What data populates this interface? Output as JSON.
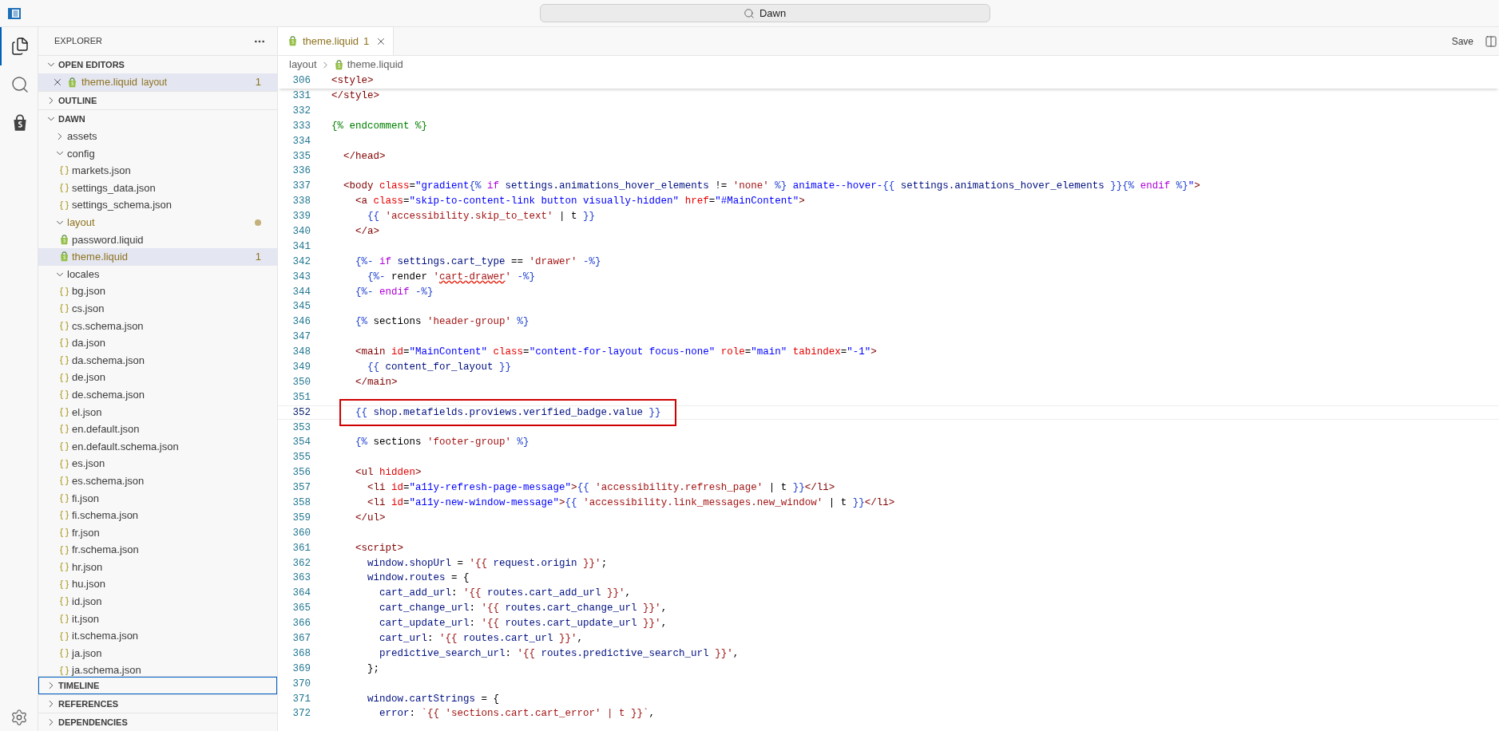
{
  "title_bar": {
    "search": "Dawn"
  },
  "activity_bar": [
    {
      "kind": "files",
      "selected": true
    },
    {
      "kind": "search",
      "selected": false
    },
    {
      "kind": "shop",
      "selected": false
    }
  ],
  "explorer": {
    "title": "EXPLORER",
    "sections": [
      {
        "label": "OPEN EDITORS",
        "expanded": true,
        "focused": false,
        "editors": [
          {
            "name": "theme.liquid",
            "folder": "layout",
            "badge": "1",
            "selected": true,
            "warning": true
          }
        ]
      },
      {
        "label": "OUTLINE",
        "expanded": false,
        "focused": false
      },
      {
        "label": "DAWN",
        "expanded": true,
        "focused": false,
        "tree": [
          {
            "name": "assets",
            "kind": "folder",
            "expanded": false,
            "modified": false,
            "selected": false,
            "warning": false
          },
          {
            "name": "config",
            "kind": "folder",
            "expanded": true,
            "modified": false,
            "selected": false,
            "warning": false,
            "children": [
              {
                "name": "markets.json",
                "kind": "json",
                "selected": false,
                "warning": false
              },
              {
                "name": "settings_data.json",
                "kind": "json",
                "selected": false,
                "warning": false
              },
              {
                "name": "settings_schema.json",
                "kind": "json",
                "selected": false,
                "warning": false
              }
            ]
          },
          {
            "name": "layout",
            "kind": "folder",
            "expanded": true,
            "modified": true,
            "selected": false,
            "warning": true,
            "children": [
              {
                "name": "password.liquid",
                "kind": "liquid",
                "selected": false,
                "warning": false
              },
              {
                "name": "theme.liquid",
                "kind": "liquid",
                "selected": true,
                "warning": true,
                "badge": "1"
              }
            ]
          },
          {
            "name": "locales",
            "kind": "folder",
            "expanded": true,
            "modified": false,
            "selected": false,
            "warning": false,
            "children": [
              {
                "name": "bg.json",
                "kind": "json",
                "selected": false,
                "warning": false
              },
              {
                "name": "cs.json",
                "kind": "json",
                "selected": false,
                "warning": false
              },
              {
                "name": "cs.schema.json",
                "kind": "json",
                "selected": false,
                "warning": false
              },
              {
                "name": "da.json",
                "kind": "json",
                "selected": false,
                "warning": false
              },
              {
                "name": "da.schema.json",
                "kind": "json",
                "selected": false,
                "warning": false
              },
              {
                "name": "de.json",
                "kind": "json",
                "selected": false,
                "warning": false
              },
              {
                "name": "de.schema.json",
                "kind": "json",
                "selected": false,
                "warning": false
              },
              {
                "name": "el.json",
                "kind": "json",
                "selected": false,
                "warning": false
              },
              {
                "name": "en.default.json",
                "kind": "json",
                "selected": false,
                "warning": false
              },
              {
                "name": "en.default.schema.json",
                "kind": "json",
                "selected": false,
                "warning": false
              },
              {
                "name": "es.json",
                "kind": "json",
                "selected": false,
                "warning": false
              },
              {
                "name": "es.schema.json",
                "kind": "json",
                "selected": false,
                "warning": false
              },
              {
                "name": "fi.json",
                "kind": "json",
                "selected": false,
                "warning": false
              },
              {
                "name": "fi.schema.json",
                "kind": "json",
                "selected": false,
                "warning": false
              },
              {
                "name": "fr.json",
                "kind": "json",
                "selected": false,
                "warning": false
              },
              {
                "name": "fr.schema.json",
                "kind": "json",
                "selected": false,
                "warning": false
              },
              {
                "name": "hr.json",
                "kind": "json",
                "selected": false,
                "warning": false
              },
              {
                "name": "hu.json",
                "kind": "json",
                "selected": false,
                "warning": false
              },
              {
                "name": "id.json",
                "kind": "json",
                "selected": false,
                "warning": false
              },
              {
                "name": "it.json",
                "kind": "json",
                "selected": false,
                "warning": false
              },
              {
                "name": "it.schema.json",
                "kind": "json",
                "selected": false,
                "warning": false
              },
              {
                "name": "ja.json",
                "kind": "json",
                "selected": false,
                "warning": false
              },
              {
                "name": "ja.schema.json",
                "kind": "json",
                "selected": false,
                "warning": false
              }
            ]
          }
        ]
      },
      {
        "label": "TIMELINE",
        "expanded": false,
        "focused": true
      },
      {
        "label": "REFERENCES",
        "expanded": false,
        "focused": false
      },
      {
        "label": "DEPENDENCIES",
        "expanded": false,
        "focused": false
      }
    ]
  },
  "tabs": [
    {
      "name": "theme.liquid",
      "badge": "1",
      "selected": true,
      "warning": true
    }
  ],
  "save": "Save",
  "breadcrumb": [
    {
      "text": "layout",
      "kind": "folder"
    },
    {
      "text": "theme.liquid",
      "kind": "liquid"
    }
  ],
  "editor": {
    "sticky": {
      "number": "306",
      "current": false,
      "boxed": false,
      "tokens": [
        {
          "kind": "tag",
          "text": "<style>"
        }
      ]
    },
    "lines": [
      {
        "number": "331",
        "current": false,
        "boxed": false,
        "tokens": [
          {
            "kind": "tag",
            "text": "</style>"
          }
        ]
      },
      {
        "number": "332",
        "current": false,
        "boxed": false
      },
      {
        "number": "333",
        "current": false,
        "boxed": false,
        "tokens": [
          {
            "kind": "comment",
            "text": "{% endcomment %}"
          }
        ]
      },
      {
        "number": "334",
        "current": false,
        "boxed": false
      },
      {
        "number": "335",
        "current": false,
        "boxed": false,
        "tokens": [
          {
            "kind": "tag",
            "text": "  </head>"
          }
        ]
      },
      {
        "number": "336",
        "current": false,
        "boxed": false
      },
      {
        "number": "337",
        "current": false,
        "boxed": false,
        "tokens": [
          {
            "kind": "tag",
            "text": "  <body"
          },
          {
            "kind": "attr",
            "text": " class"
          },
          {
            "kind": "plain",
            "text": "="
          },
          {
            "kind": "string",
            "text": "\"gradient"
          },
          {
            "kind": "delim",
            "text": "{%"
          },
          {
            "kind": "keyword",
            "text": " if"
          },
          {
            "kind": "variable",
            "text": " settings.animations_hover_elements"
          },
          {
            "kind": "plain",
            "text": " != "
          },
          {
            "kind": "quote",
            "text": "'none'"
          },
          {
            "kind": "delim",
            "text": " %}"
          },
          {
            "kind": "string",
            "text": " animate--hover-"
          },
          {
            "kind": "delim",
            "text": "{{"
          },
          {
            "kind": "variable",
            "text": " settings.animations_hover_elements"
          },
          {
            "kind": "delim",
            "text": " }}{%"
          },
          {
            "kind": "keyword",
            "text": " endif"
          },
          {
            "kind": "delim",
            "text": " %}"
          },
          {
            "kind": "string",
            "text": "\""
          },
          {
            "kind": "tag",
            "text": ">"
          }
        ]
      },
      {
        "number": "338",
        "current": false,
        "boxed": false,
        "tokens": [
          {
            "kind": "tag",
            "text": "    <a"
          },
          {
            "kind": "attr",
            "text": " class"
          },
          {
            "kind": "plain",
            "text": "="
          },
          {
            "kind": "string",
            "text": "\"skip-to-content-link button visually-hidden\""
          },
          {
            "kind": "attr",
            "text": " href"
          },
          {
            "kind": "plain",
            "text": "="
          },
          {
            "kind": "string",
            "text": "\"#MainContent\""
          },
          {
            "kind": "tag",
            "text": ">"
          }
        ]
      },
      {
        "number": "339",
        "current": false,
        "boxed": false,
        "tokens": [
          {
            "kind": "delim",
            "text": "      {{"
          },
          {
            "kind": "quote",
            "text": " 'accessibility.skip_to_text'"
          },
          {
            "kind": "plain",
            "text": " | t "
          },
          {
            "kind": "delim",
            "text": "}}"
          }
        ]
      },
      {
        "number": "340",
        "current": false,
        "boxed": false,
        "tokens": [
          {
            "kind": "tag",
            "text": "    </a>"
          }
        ]
      },
      {
        "number": "341",
        "current": false,
        "boxed": false
      },
      {
        "number": "342",
        "current": false,
        "boxed": false,
        "tokens": [
          {
            "kind": "delim",
            "text": "    {%-"
          },
          {
            "kind": "keyword",
            "text": " if"
          },
          {
            "kind": "variable",
            "text": " settings.cart_type"
          },
          {
            "kind": "plain",
            "text": " == "
          },
          {
            "kind": "quote",
            "text": "'drawer'"
          },
          {
            "kind": "delim",
            "text": " -%}"
          }
        ]
      },
      {
        "number": "343",
        "current": false,
        "boxed": false,
        "tokens": [
          {
            "kind": "delim",
            "text": "      {%-"
          },
          {
            "kind": "plain",
            "text": " render "
          },
          {
            "kind": "quote",
            "text": "'"
          },
          {
            "kind": "error",
            "text": "cart-drawer"
          },
          {
            "kind": "quote",
            "text": "'"
          },
          {
            "kind": "delim",
            "text": " -%}"
          }
        ]
      },
      {
        "number": "344",
        "current": false,
        "boxed": false,
        "tokens": [
          {
            "kind": "delim",
            "text": "    {%-"
          },
          {
            "kind": "keyword",
            "text": " endif"
          },
          {
            "kind": "delim",
            "text": " -%}"
          }
        ]
      },
      {
        "number": "345",
        "current": false,
        "boxed": false
      },
      {
        "number": "346",
        "current": false,
        "boxed": false,
        "tokens": [
          {
            "kind": "delim",
            "text": "    {%"
          },
          {
            "kind": "plain",
            "text": " sections "
          },
          {
            "kind": "quote",
            "text": "'header-group'"
          },
          {
            "kind": "delim",
            "text": " %}"
          }
        ]
      },
      {
        "number": "347",
        "current": false,
        "boxed": false
      },
      {
        "number": "348",
        "current": false,
        "boxed": false,
        "tokens": [
          {
            "kind": "tag",
            "text": "    <main"
          },
          {
            "kind": "attr",
            "text": " id"
          },
          {
            "kind": "plain",
            "text": "="
          },
          {
            "kind": "string",
            "text": "\"MainContent\""
          },
          {
            "kind": "attr",
            "text": " class"
          },
          {
            "kind": "plain",
            "text": "="
          },
          {
            "kind": "string",
            "text": "\"content-for-layout focus-none\""
          },
          {
            "kind": "attr",
            "text": " role"
          },
          {
            "kind": "plain",
            "text": "="
          },
          {
            "kind": "string",
            "text": "\"main\""
          },
          {
            "kind": "attr",
            "text": " tabindex"
          },
          {
            "kind": "plain",
            "text": "="
          },
          {
            "kind": "string",
            "text": "\"-1\""
          },
          {
            "kind": "tag",
            "text": ">"
          }
        ]
      },
      {
        "number": "349",
        "current": false,
        "boxed": false,
        "tokens": [
          {
            "kind": "delim",
            "text": "      {{"
          },
          {
            "kind": "variable",
            "text": " content_for_layout"
          },
          {
            "kind": "delim",
            "text": " }}"
          }
        ]
      },
      {
        "number": "350",
        "current": false,
        "boxed": false,
        "tokens": [
          {
            "kind": "tag",
            "text": "    </main>"
          }
        ]
      },
      {
        "number": "351",
        "current": false,
        "boxed": false
      },
      {
        "number": "352",
        "current": true,
        "boxed": true,
        "tokens": [
          {
            "kind": "delim",
            "text": "    {{"
          },
          {
            "kind": "variable",
            "text": " shop.metafields.proviews.verified_badge.value"
          },
          {
            "kind": "delim",
            "text": " }}"
          }
        ]
      },
      {
        "number": "353",
        "current": false,
        "boxed": false
      },
      {
        "number": "354",
        "current": false,
        "boxed": false,
        "tokens": [
          {
            "kind": "delim",
            "text": "    {%"
          },
          {
            "kind": "plain",
            "text": " sections "
          },
          {
            "kind": "quote",
            "text": "'footer-group'"
          },
          {
            "kind": "delim",
            "text": " %}"
          }
        ]
      },
      {
        "number": "355",
        "current": false,
        "boxed": false
      },
      {
        "number": "356",
        "current": false,
        "boxed": false,
        "tokens": [
          {
            "kind": "tag",
            "text": "    <ul"
          },
          {
            "kind": "attr",
            "text": " hidden"
          },
          {
            "kind": "tag",
            "text": ">"
          }
        ]
      },
      {
        "number": "357",
        "current": false,
        "boxed": false,
        "tokens": [
          {
            "kind": "tag",
            "text": "      <li"
          },
          {
            "kind": "attr",
            "text": " id"
          },
          {
            "kind": "plain",
            "text": "="
          },
          {
            "kind": "string",
            "text": "\"a11y-refresh-page-message\""
          },
          {
            "kind": "tag",
            "text": ">"
          },
          {
            "kind": "delim",
            "text": "{{"
          },
          {
            "kind": "quote",
            "text": " 'accessibility.refresh_page'"
          },
          {
            "kind": "plain",
            "text": " | t "
          },
          {
            "kind": "delim",
            "text": "}}"
          },
          {
            "kind": "tag",
            "text": "</li>"
          }
        ]
      },
      {
        "number": "358",
        "current": false,
        "boxed": false,
        "tokens": [
          {
            "kind": "tag",
            "text": "      <li"
          },
          {
            "kind": "attr",
            "text": " id"
          },
          {
            "kind": "plain",
            "text": "="
          },
          {
            "kind": "string",
            "text": "\"a11y-new-window-message\""
          },
          {
            "kind": "tag",
            "text": ">"
          },
          {
            "kind": "delim",
            "text": "{{"
          },
          {
            "kind": "quote",
            "text": " 'accessibility.link_messages.new_window'"
          },
          {
            "kind": "plain",
            "text": " | t "
          },
          {
            "kind": "delim",
            "text": "}}"
          },
          {
            "kind": "tag",
            "text": "</li>"
          }
        ]
      },
      {
        "number": "359",
        "current": false,
        "boxed": false,
        "tokens": [
          {
            "kind": "tag",
            "text": "    </ul>"
          }
        ]
      },
      {
        "number": "360",
        "current": false,
        "boxed": false
      },
      {
        "number": "361",
        "current": false,
        "boxed": false,
        "tokens": [
          {
            "kind": "tag",
            "text": "    <script>"
          }
        ]
      },
      {
        "number": "362",
        "current": false,
        "boxed": false,
        "tokens": [
          {
            "kind": "variable",
            "text": "      window.shopUrl"
          },
          {
            "kind": "plain",
            "text": " = "
          },
          {
            "kind": "quote",
            "text": "'{{"
          },
          {
            "kind": "variable",
            "text": " request.origin"
          },
          {
            "kind": "quote",
            "text": " }}'"
          },
          {
            "kind": "plain",
            "text": ";"
          }
        ]
      },
      {
        "number": "363",
        "current": false,
        "boxed": false,
        "tokens": [
          {
            "kind": "variable",
            "text": "      window.routes"
          },
          {
            "kind": "plain",
            "text": " = {"
          }
        ]
      },
      {
        "number": "364",
        "current": false,
        "boxed": false,
        "tokens": [
          {
            "kind": "variable",
            "text": "        cart_add_url"
          },
          {
            "kind": "plain",
            "text": ": "
          },
          {
            "kind": "quote",
            "text": "'{{"
          },
          {
            "kind": "variable",
            "text": " routes.cart_add_url"
          },
          {
            "kind": "quote",
            "text": " }}'"
          },
          {
            "kind": "plain",
            "text": ","
          }
        ]
      },
      {
        "number": "365",
        "current": false,
        "boxed": false,
        "tokens": [
          {
            "kind": "variable",
            "text": "        cart_change_url"
          },
          {
            "kind": "plain",
            "text": ": "
          },
          {
            "kind": "quote",
            "text": "'{{"
          },
          {
            "kind": "variable",
            "text": " routes.cart_change_url"
          },
          {
            "kind": "quote",
            "text": " }}'"
          },
          {
            "kind": "plain",
            "text": ","
          }
        ]
      },
      {
        "number": "366",
        "current": false,
        "boxed": false,
        "tokens": [
          {
            "kind": "variable",
            "text": "        cart_update_url"
          },
          {
            "kind": "plain",
            "text": ": "
          },
          {
            "kind": "quote",
            "text": "'{{"
          },
          {
            "kind": "variable",
            "text": " routes.cart_update_url"
          },
          {
            "kind": "quote",
            "text": " }}'"
          },
          {
            "kind": "plain",
            "text": ","
          }
        ]
      },
      {
        "number": "367",
        "current": false,
        "boxed": false,
        "tokens": [
          {
            "kind": "variable",
            "text": "        cart_url"
          },
          {
            "kind": "plain",
            "text": ": "
          },
          {
            "kind": "quote",
            "text": "'{{"
          },
          {
            "kind": "variable",
            "text": " routes.cart_url"
          },
          {
            "kind": "quote",
            "text": " }}'"
          },
          {
            "kind": "plain",
            "text": ","
          }
        ]
      },
      {
        "number": "368",
        "current": false,
        "boxed": false,
        "tokens": [
          {
            "kind": "variable",
            "text": "        predictive_search_url"
          },
          {
            "kind": "plain",
            "text": ": "
          },
          {
            "kind": "quote",
            "text": "'{{"
          },
          {
            "kind": "variable",
            "text": " routes.predictive_search_url"
          },
          {
            "kind": "quote",
            "text": " }}'"
          },
          {
            "kind": "plain",
            "text": ","
          }
        ]
      },
      {
        "number": "369",
        "current": false,
        "boxed": false,
        "tokens": [
          {
            "kind": "plain",
            "text": "      };"
          }
        ]
      },
      {
        "number": "370",
        "current": false,
        "boxed": false
      },
      {
        "number": "371",
        "current": false,
        "boxed": false,
        "tokens": [
          {
            "kind": "variable",
            "text": "      window.cartStrings"
          },
          {
            "kind": "plain",
            "text": " = {"
          }
        ]
      },
      {
        "number": "372",
        "current": false,
        "boxed": false,
        "tokens": [
          {
            "kind": "variable",
            "text": "        error"
          },
          {
            "kind": "plain",
            "text": ": "
          },
          {
            "kind": "quote",
            "text": "`{{ 'sections.cart.cart_error' | t }}`"
          },
          {
            "kind": "plain",
            "text": ","
          }
        ]
      }
    ]
  }
}
